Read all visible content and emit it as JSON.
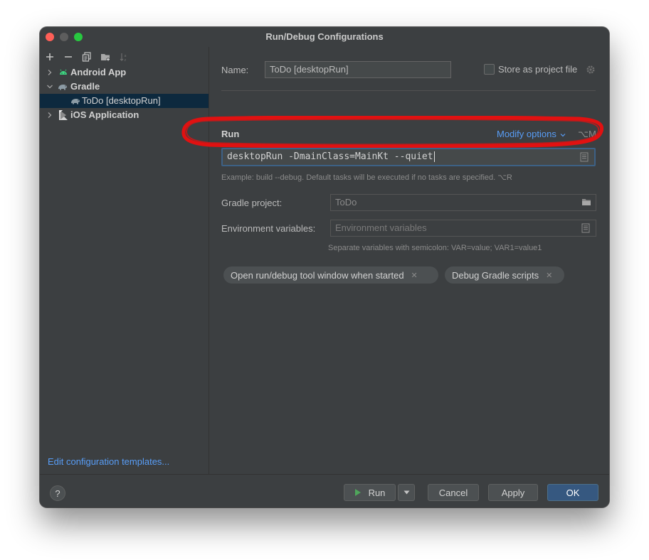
{
  "window": {
    "title": "Run/Debug Configurations"
  },
  "sidebar": {
    "tree": [
      {
        "label": "Android App",
        "icon": "android-icon"
      },
      {
        "label": "Gradle",
        "icon": "gradle-elephant-icon"
      },
      {
        "label": "ToDo [desktopRun]",
        "icon": "gradle-elephant-icon"
      },
      {
        "label": "iOS Application",
        "icon": "ios-app-icon"
      }
    ],
    "edit_templates_link": "Edit configuration templates..."
  },
  "form": {
    "name_label": "Name:",
    "name_value": "ToDo [desktopRun]",
    "store_label": "Store as project file",
    "run_section": "Run",
    "modify_options": "Modify options",
    "modify_shortcut": "⌥M",
    "task_value": "desktopRun -DmainClass=MainKt --quiet",
    "task_hint": "Example: build --debug. Default tasks will be executed if no tasks are specified. ⌥R",
    "gradle_project_label": "Gradle project:",
    "gradle_project_value": "ToDo",
    "env_label": "Environment variables:",
    "env_placeholder": "Environment variables",
    "env_hint": "Separate variables with semicolon: VAR=value; VAR1=value1",
    "chips": [
      "Open run/debug tool window when started",
      "Debug Gradle scripts"
    ]
  },
  "buttons": {
    "help": "?",
    "run": "Run",
    "cancel": "Cancel",
    "apply": "Apply",
    "ok": "OK"
  },
  "colors": {
    "accent_link": "#589df6",
    "primary_button": "#365880",
    "annotation_red": "#e11111"
  }
}
